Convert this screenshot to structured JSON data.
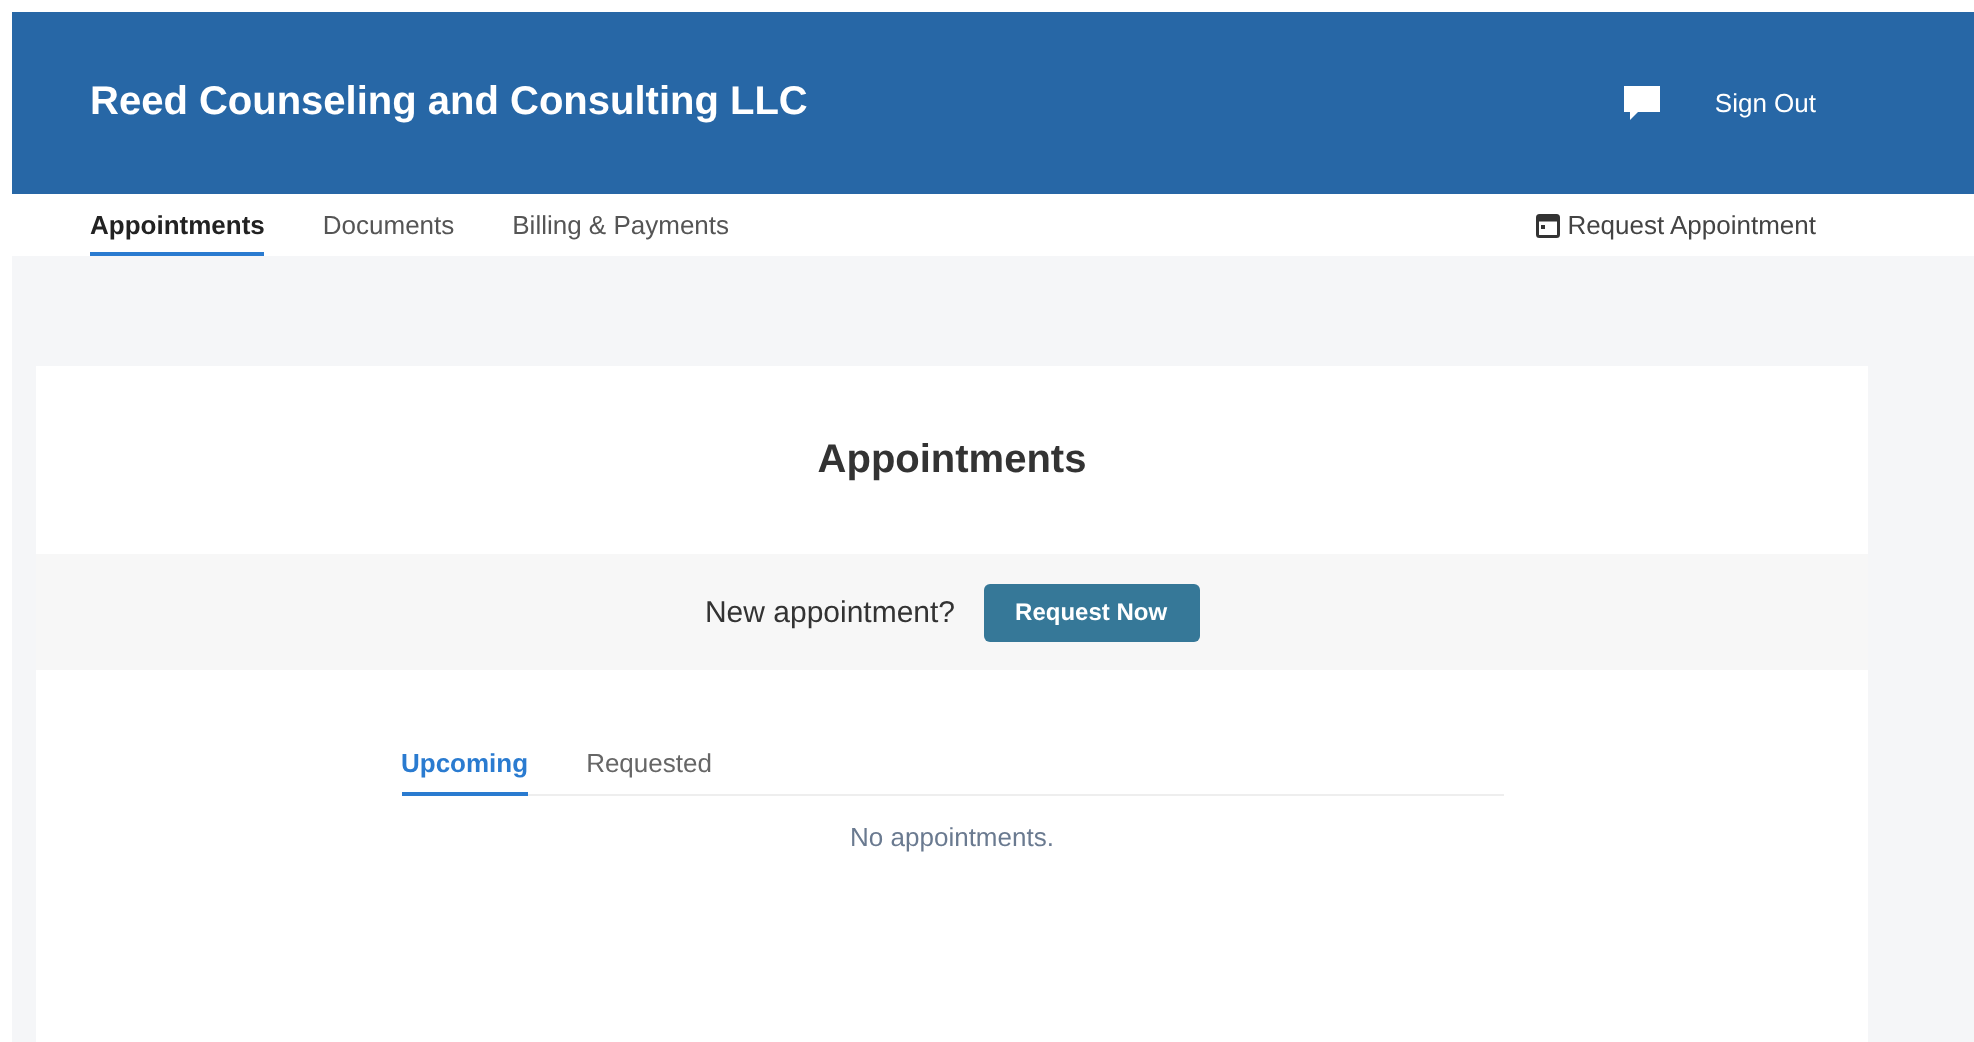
{
  "header": {
    "title": "Reed Counseling and Consulting LLC",
    "sign_out": "Sign Out"
  },
  "nav": {
    "tabs": [
      {
        "label": "Appointments",
        "selected": true
      },
      {
        "label": "Documents",
        "selected": false
      },
      {
        "label": "Billing & Payments",
        "selected": false
      }
    ],
    "request_link": "Request Appointment"
  },
  "card": {
    "title": "Appointments",
    "prompt": "New appointment?",
    "button": "Request Now",
    "tabs": [
      {
        "label": "Upcoming",
        "selected": true
      },
      {
        "label": "Requested",
        "selected": false
      }
    ],
    "empty_message": "No appointments."
  }
}
